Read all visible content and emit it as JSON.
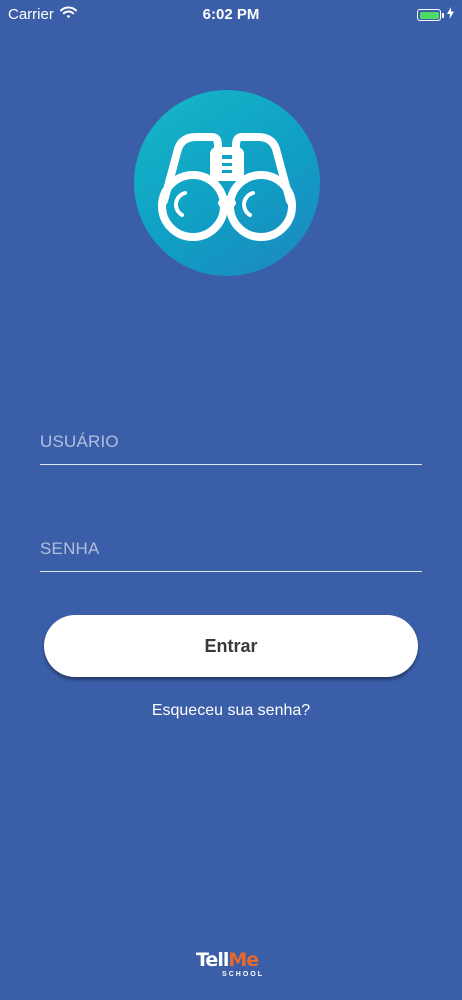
{
  "status_bar": {
    "carrier": "Carrier",
    "time": "6:02 PM",
    "wifi_icon": "wifi-icon",
    "battery_icon": "battery-icon",
    "charging_icon": "bolt-icon"
  },
  "logo": {
    "icon": "binoculars-icon",
    "gradient_colors": [
      "#16b8c8",
      "#1f86c0"
    ]
  },
  "form": {
    "username_placeholder": "USUÁRIO",
    "username_value": "",
    "password_placeholder": "SENHA",
    "password_value": "",
    "submit_label": "Entrar",
    "forgot_password_label": "Esqueceu sua senha?"
  },
  "brand": {
    "name_part_1": "Tell",
    "name_part_2": "Me",
    "subtitle": "SCHOOL",
    "accent_color": "#e8692c"
  },
  "colors": {
    "background": "#3a5ea8",
    "button_background": "#ffffff",
    "button_text": "#3a3a3a",
    "battery_fill": "#4cd964"
  }
}
